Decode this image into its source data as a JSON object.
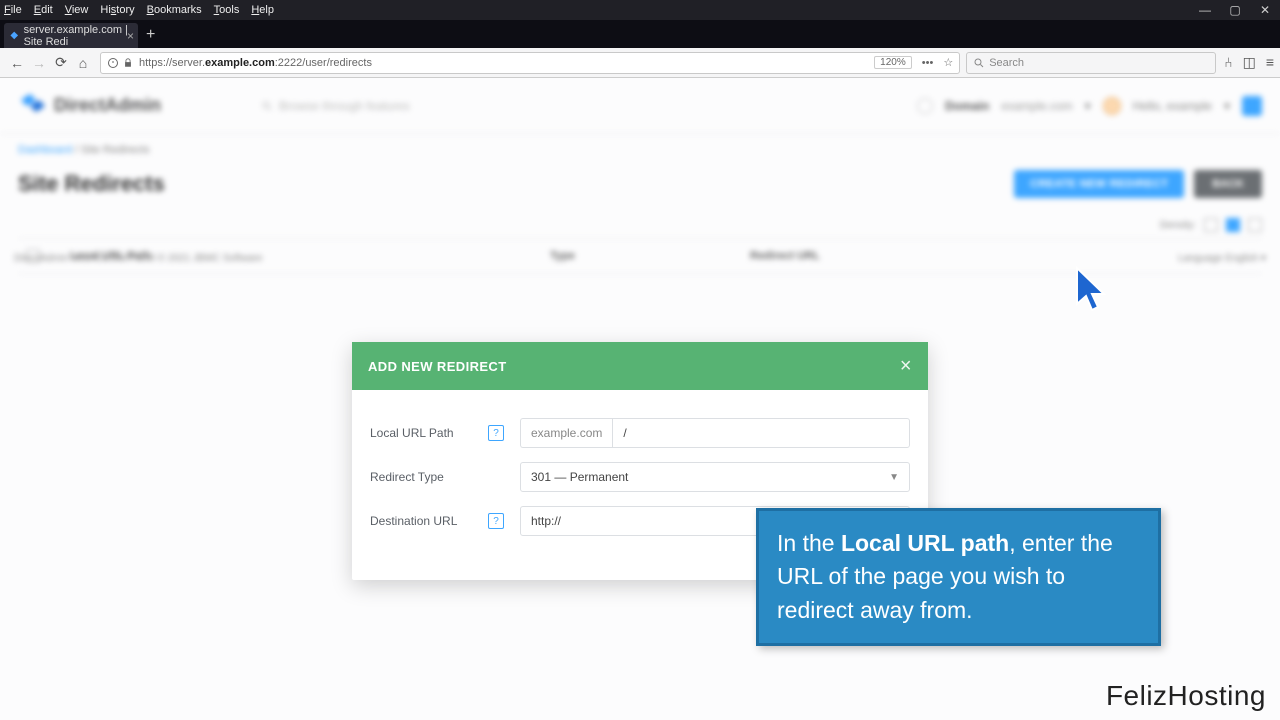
{
  "browser": {
    "menus": [
      "File",
      "Edit",
      "View",
      "History",
      "Bookmarks",
      "Tools",
      "Help"
    ],
    "tab_title": "server.example.com | Site Redi",
    "url_prefix": "https://server.",
    "url_bold": "example.com",
    "url_suffix": ":2222/user/redirects",
    "zoom": "120%",
    "search_placeholder": "Search"
  },
  "app": {
    "brand": "DirectAdmin",
    "search_hint": "Browse through features",
    "domain_label": "Domain",
    "domain_value": "example.com",
    "greeting": "Hello, example"
  },
  "breadcrumb": {
    "root": "Dashboard",
    "here": "Site Redirects"
  },
  "page_title": "Site Redirects",
  "buttons": {
    "create": "CREATE NEW REDIRECT",
    "back": "BACK"
  },
  "density_label": "Density:",
  "columns": {
    "c1": "Local URL Path",
    "c2": "Type",
    "c3": "Redirect URL"
  },
  "modal": {
    "title": "ADD NEW REDIRECT",
    "local_label": "Local URL Path",
    "redirect_type_label": "Redirect Type",
    "destination_label": "Destination URL",
    "domain_prefix": "example.com",
    "local_value": "/",
    "redirect_type_value": "301 — Permanent",
    "destination_value": "http://"
  },
  "caption_parts": {
    "a": "In the ",
    "b": "Local URL path",
    "c": ", enter the URL of the page you wish to redirect away from."
  },
  "footer_left": "DirectAdmin Web Control Panel © 2021 JBMC Software",
  "footer_right": "Language   English ▾",
  "watermark": "FelizHosting"
}
